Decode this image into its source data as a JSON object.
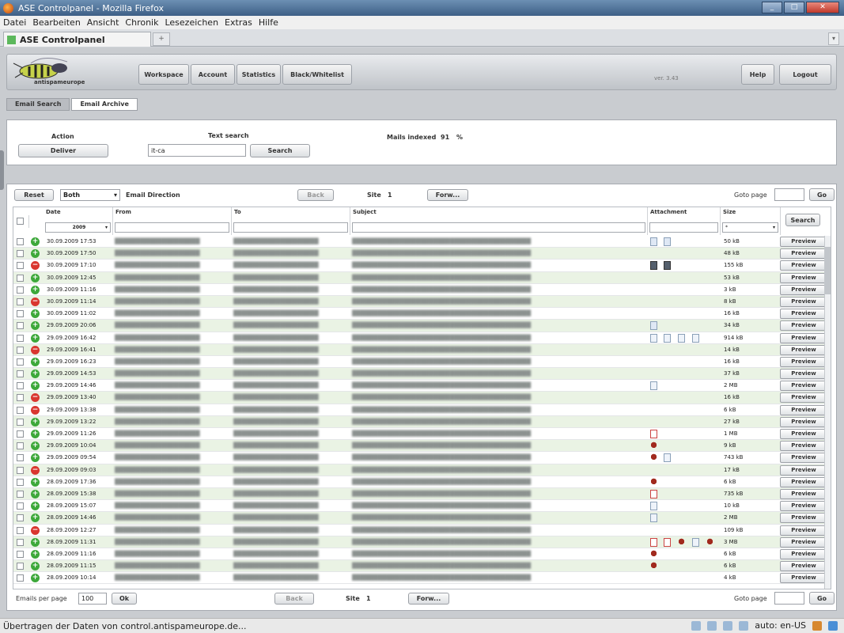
{
  "window": {
    "title": "ASE Controlpanel - Mozilla Firefox"
  },
  "menu": [
    "Datei",
    "Bearbeiten",
    "Ansicht",
    "Chronik",
    "Lesezeichen",
    "Extras",
    "Hilfe"
  ],
  "browser_tab": {
    "label": "ASE Controlpanel"
  },
  "logo": {
    "text": "antispameurope"
  },
  "nav": {
    "workspace": "Workspace",
    "account": "Account",
    "statistics": "Statistics",
    "blackwhite": "Black/Whitelist",
    "help": "Help",
    "logout": "Logout",
    "version": "ver. 3.43"
  },
  "subtabs": {
    "search": "Email Search",
    "archive": "Email Archive"
  },
  "search_panel": {
    "action_label": "Action",
    "deliver": "Deliver",
    "text_search_label": "Text search",
    "text_search_value": "it-ca",
    "search_button": "Search",
    "mails_indexed_label": "Mails indexed",
    "mails_indexed_value": "91",
    "percent": "%"
  },
  "toolbar": {
    "reset": "Reset",
    "direction_value": "Both",
    "direction_label": "Email Direction",
    "back": "Back",
    "site_label": "Site",
    "site_value": "1",
    "forward": "Forw...",
    "goto_label": "Goto page",
    "go": "Go"
  },
  "columns": {
    "date": "Date",
    "from": "From",
    "to": "To",
    "subject": "Subject",
    "attachment": "Attachment",
    "size": "Size",
    "search": "Search",
    "year_filter": "2009",
    "size_filter": "*"
  },
  "preview_label": "Preview",
  "rows": [
    {
      "date": "30.09.2009 17:53",
      "status": "ok",
      "size": "50 kB",
      "att": [
        "doc",
        "doc"
      ]
    },
    {
      "date": "30.09.2009 17:50",
      "status": "ok",
      "size": "48 kB",
      "att": []
    },
    {
      "date": "30.09.2009 17:10",
      "status": "blk",
      "size": "155 kB",
      "att": [
        "img",
        "img"
      ]
    },
    {
      "date": "30.09.2009 12:45",
      "status": "ok",
      "size": "53 kB",
      "att": []
    },
    {
      "date": "30.09.2009 11:16",
      "status": "ok",
      "size": "3 kB",
      "att": []
    },
    {
      "date": "30.09.2009 11:14",
      "status": "blk",
      "size": "8 kB",
      "att": []
    },
    {
      "date": "30.09.2009 11:02",
      "status": "ok",
      "size": "16 kB",
      "att": []
    },
    {
      "date": "29.09.2009 20:06",
      "status": "ok",
      "size": "34 kB",
      "att": [
        "doc"
      ]
    },
    {
      "date": "29.09.2009 16:42",
      "status": "ok",
      "size": "914 kB",
      "att": [
        "file",
        "file",
        "file",
        "file"
      ]
    },
    {
      "date": "29.09.2009 16:41",
      "status": "blk",
      "size": "14 kB",
      "att": []
    },
    {
      "date": "29.09.2009 16:23",
      "status": "ok",
      "size": "16 kB",
      "att": []
    },
    {
      "date": "29.09.2009 14:53",
      "status": "ok",
      "size": "37 kB",
      "att": []
    },
    {
      "date": "29.09.2009 14:46",
      "status": "ok",
      "size": "2 MB",
      "att": [
        "file"
      ]
    },
    {
      "date": "29.09.2009 13:40",
      "status": "blk",
      "size": "16 kB",
      "att": []
    },
    {
      "date": "29.09.2009 13:38",
      "status": "blk",
      "size": "6 kB",
      "att": []
    },
    {
      "date": "29.09.2009 13:22",
      "status": "ok",
      "size": "27 kB",
      "att": []
    },
    {
      "date": "29.09.2009 11:26",
      "status": "ok",
      "size": "1 MB",
      "att": [
        "pdf"
      ]
    },
    {
      "date": "29.09.2009 10:04",
      "status": "ok",
      "size": "9 kB",
      "att": [
        "cert"
      ]
    },
    {
      "date": "29.09.2009 09:54",
      "status": "ok",
      "size": "743 kB",
      "att": [
        "cert",
        "file"
      ]
    },
    {
      "date": "29.09.2009 09:03",
      "status": "blk",
      "size": "17 kB",
      "att": []
    },
    {
      "date": "28.09.2009 17:36",
      "status": "ok",
      "size": "6 kB",
      "att": [
        "cert"
      ]
    },
    {
      "date": "28.09.2009 15:38",
      "status": "ok",
      "size": "735 kB",
      "att": [
        "pdf"
      ]
    },
    {
      "date": "28.09.2009 15:07",
      "status": "ok",
      "size": "10 kB",
      "att": [
        "file"
      ]
    },
    {
      "date": "28.09.2009 14:46",
      "status": "ok",
      "size": "2 MB",
      "att": [
        "file"
      ]
    },
    {
      "date": "28.09.2009 12:27",
      "status": "blk",
      "size": "109 kB",
      "att": []
    },
    {
      "date": "28.09.2009 11:31",
      "status": "ok",
      "size": "3 MB",
      "att": [
        "pdf",
        "pdf",
        "cert",
        "file",
        "cert"
      ]
    },
    {
      "date": "28.09.2009 11:16",
      "status": "ok",
      "size": "6 kB",
      "att": [
        "cert"
      ]
    },
    {
      "date": "28.09.2009 11:15",
      "status": "ok",
      "size": "6 kB",
      "att": [
        "cert"
      ]
    },
    {
      "date": "28.09.2009 10:14",
      "status": "ok",
      "size": "4 kB",
      "att": []
    }
  ],
  "footer": {
    "per_page_label": "Emails per page",
    "per_page_value": "100",
    "ok": "Ok",
    "back": "Back",
    "site_label": "Site",
    "site_value": "1",
    "forward": "Forw...",
    "goto_label": "Goto page",
    "go": "Go"
  },
  "statusbar": {
    "text": "Übertragen der Daten von control.antispameurope.de...",
    "locale": "auto: en-US"
  }
}
